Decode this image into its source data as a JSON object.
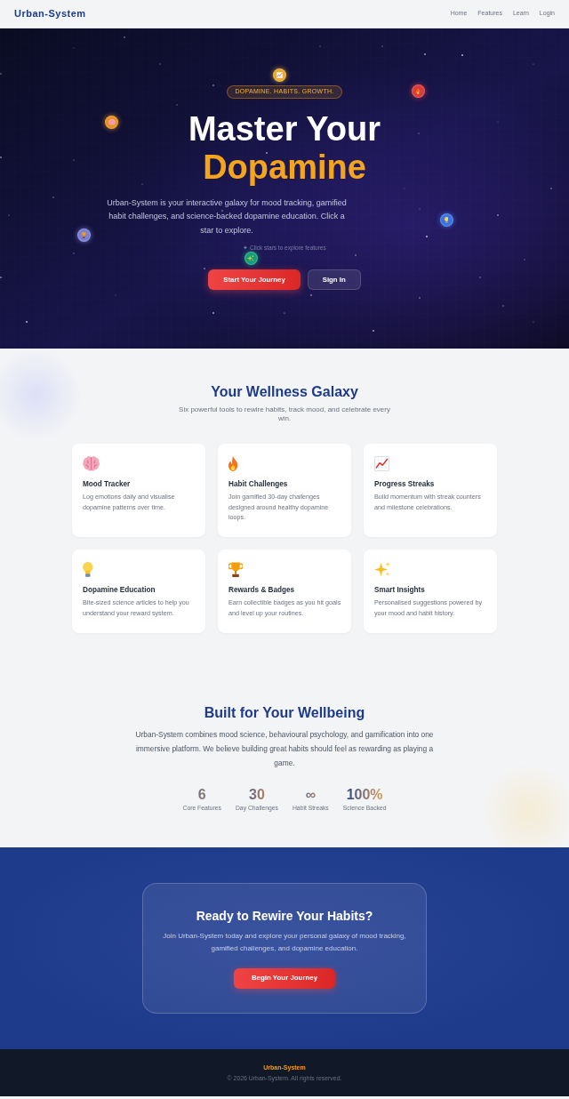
{
  "nav": {
    "logo": "Urban-System",
    "links": [
      "Home",
      "Features",
      "Learn",
      "Login"
    ]
  },
  "hero": {
    "stars": [
      {
        "color": "#e9a92a"
      },
      {
        "color": "#dc3b3b"
      },
      {
        "color": "#e8911c"
      },
      {
        "color": "#3b74e0"
      },
      {
        "color": "#7a7fd6"
      },
      {
        "color": "#13a078"
      }
    ],
    "badge": "DOPAMINE. HABITS. GROWTH.",
    "title": "Master Your",
    "highlight": "Dopamine",
    "description": "Urban-System is your interactive galaxy for mood tracking, gamified habit challenges, and science-backed dopamine education. Click a star to explore.",
    "hint": "✦ Click stars to explore features",
    "buttons": [
      {
        "label": "Start Your Journey",
        "kind": "primary"
      },
      {
        "label": "Sign In",
        "kind": "secondary"
      }
    ]
  },
  "features": {
    "title": "Your Wellness Galaxy",
    "subtitle": "Six powerful tools to rewire habits, track mood, and celebrate every win.",
    "cards": [
      {
        "title": "Mood Tracker",
        "description": "Log emotions daily and visualise dopamine patterns over time."
      },
      {
        "title": "Habit Challenges",
        "description": "Join gamified 30-day challenges designed around healthy dopamine loops."
      },
      {
        "title": "Progress Streaks",
        "description": "Build momentum with streak counters and milestone celebrations."
      },
      {
        "title": "Dopamine Education",
        "description": "Bite-sized science articles to help you understand your reward system."
      },
      {
        "title": "Rewards & Badges",
        "description": "Earn collectible badges as you hit goals and level up your routines."
      },
      {
        "title": "Smart Insights",
        "description": "Personalised suggestions powered by your mood and habit history."
      }
    ]
  },
  "about": {
    "title": "Built for Your Wellbeing",
    "text": "Urban-System combines mood science, behavioural psychology, and gamification into one immersive platform. We believe building great habits should feel as rewarding as playing a game.",
    "stats": [
      {
        "value": "6",
        "label": "Core Features"
      },
      {
        "value": "30",
        "label": "Day Challenges"
      },
      {
        "value": "∞",
        "label": "Habit Streaks"
      },
      {
        "value": "100%",
        "label": "Science Backed"
      }
    ]
  },
  "cta": {
    "title": "Ready to Rewire Your Habits?",
    "text": "Join Urban-System today and explore your personal galaxy of mood tracking, gamified challenges, and dopamine education.",
    "button": "Begin Your Journey"
  },
  "footer": {
    "brand": "Urban-System",
    "copyright": "© 2026 Urban-System. All rights reserved."
  }
}
